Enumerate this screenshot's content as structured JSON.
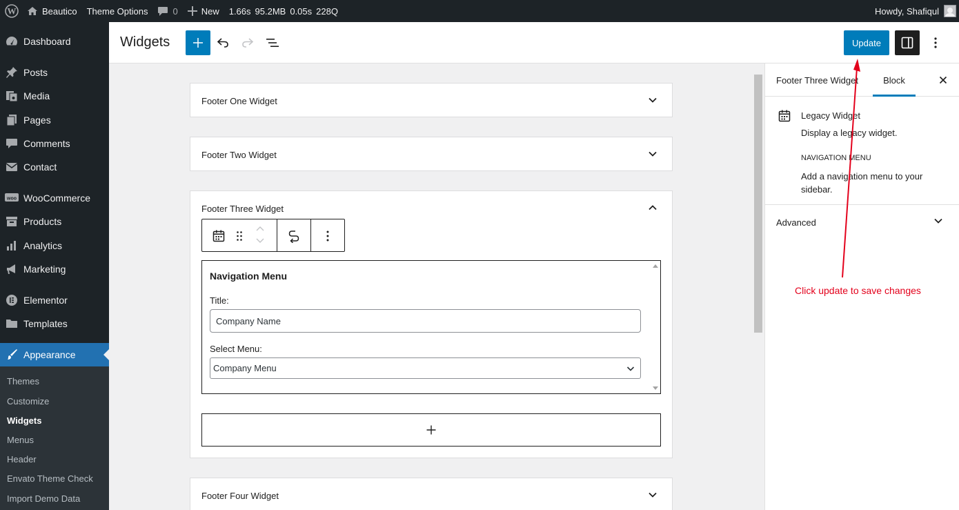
{
  "admin_bar": {
    "site_name": "Beautico",
    "theme_options": "Theme Options",
    "comments_count": "0",
    "new_label": "New",
    "stats": [
      "1.66s",
      "95.2MB",
      "0.05s",
      "228Q"
    ],
    "greeting": "Howdy, Shafiqul"
  },
  "admin_menu": {
    "items": [
      {
        "label": "Dashboard",
        "icon": "dashboard-icon"
      },
      {
        "label": "Posts",
        "icon": "pin-icon"
      },
      {
        "label": "Media",
        "icon": "media-icon"
      },
      {
        "label": "Pages",
        "icon": "pages-icon"
      },
      {
        "label": "Comments",
        "icon": "comment-icon"
      },
      {
        "label": "Contact",
        "icon": "mail-icon"
      },
      {
        "label": "WooCommerce",
        "icon": "woo-icon"
      },
      {
        "label": "Products",
        "icon": "archive-icon"
      },
      {
        "label": "Analytics",
        "icon": "bar-chart-icon"
      },
      {
        "label": "Marketing",
        "icon": "megaphone-icon"
      },
      {
        "label": "Elementor",
        "icon": "elementor-icon"
      },
      {
        "label": "Templates",
        "icon": "folder-icon"
      },
      {
        "label": "Appearance",
        "icon": "paintbrush-icon"
      }
    ],
    "submenu": [
      "Themes",
      "Customize",
      "Widgets",
      "Menus",
      "Header",
      "Envato Theme Check",
      "Import Demo Data"
    ],
    "active_submenu": "Widgets"
  },
  "header": {
    "title": "Widgets",
    "update_label": "Update"
  },
  "widget_areas": [
    {
      "title": "Footer One Widget",
      "expanded": false
    },
    {
      "title": "Footer Two Widget",
      "expanded": false
    },
    {
      "title": "Footer Three Widget",
      "expanded": true
    },
    {
      "title": "Footer Four Widget",
      "expanded": false
    }
  ],
  "legacy_widget": {
    "heading": "Navigation Menu",
    "title_label": "Title:",
    "title_value": "Company Name",
    "menu_label": "Select Menu:",
    "menu_value": "Company Menu"
  },
  "sidebar": {
    "tab_area": "Footer Three Widget",
    "tab_block": "Block",
    "block_title": "Legacy Widget",
    "block_desc": "Display a legacy widget.",
    "widget_name": "Navigation Menu",
    "widget_desc": "Add a navigation menu to your sidebar.",
    "advanced_label": "Advanced"
  },
  "annotation": {
    "text": "Click update to save changes",
    "color": "#e3001b"
  },
  "colors": {
    "accent": "#007cba",
    "admin_dark": "#1d2327",
    "menu_active": "#2271b1"
  }
}
